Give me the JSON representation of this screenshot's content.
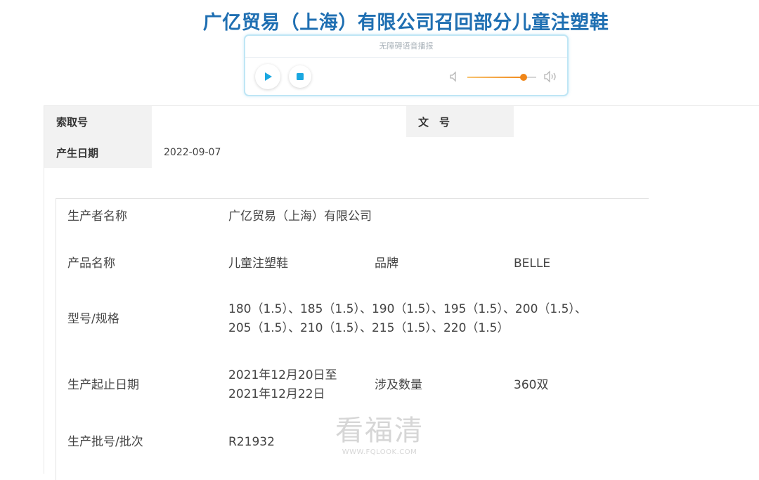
{
  "page": {
    "title": "广亿贸易（上海）有限公司召回部分儿童注塑鞋"
  },
  "player": {
    "caption": "无障碍语音播报",
    "volume_percent": 82,
    "colors": {
      "accent": "#1aa7e0",
      "knob": "#f08618"
    }
  },
  "meta": {
    "index_label": "索取号",
    "index_value": "",
    "doc_label": "文　号",
    "doc_value": "",
    "date_label": "产生日期",
    "date_value": "2022-09-07"
  },
  "details": {
    "manufacturer_label": "生产者名称",
    "manufacturer_value": "广亿贸易（上海）有限公司",
    "product_label": "产品名称",
    "product_value": "儿童注塑鞋",
    "brand_label": "品牌",
    "brand_value": "BELLE",
    "model_label": "型号/规格",
    "model_line1": "180（1.5）、185（1.5）、190（1.5）、195（1.5）、200（1.5）、",
    "model_line2": "205（1.5）、210（1.5）、215（1.5）、220（1.5）",
    "date_range_label": "生产起止日期",
    "date_range_line1": "2021年12月20日至",
    "date_range_line2": "2021年12月22日",
    "quantity_label": "涉及数量",
    "quantity_value": "360双",
    "batch_label": "生产批号/批次",
    "batch_value": "R21932"
  },
  "watermark": {
    "text": "看福清",
    "url": "WWW.FQLOOK.COM"
  }
}
